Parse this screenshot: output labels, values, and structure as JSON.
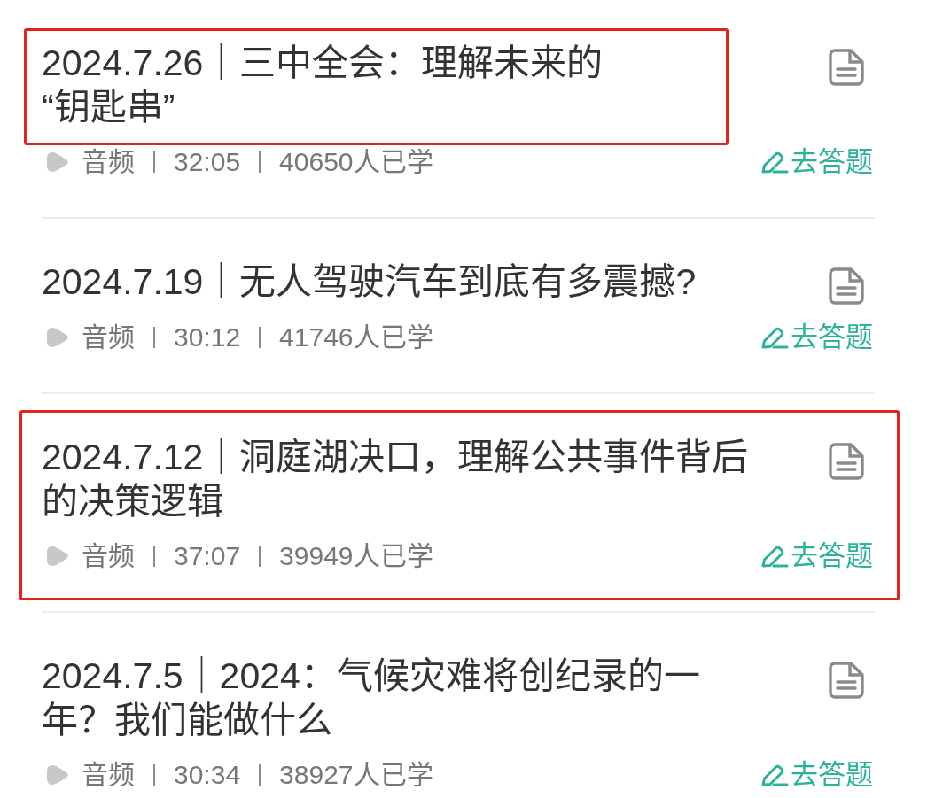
{
  "items": [
    {
      "title": "2024.7.26｜三中全会：理解未来的“钥匙串”",
      "title_highlighted": true,
      "highlighted": false,
      "type": "音频",
      "duration": "32:05",
      "learners": "40650人已学",
      "action": "去答题"
    },
    {
      "title": "2024.7.19｜无人驾驶汽车到底有多震撼?",
      "title_highlighted": false,
      "highlighted": false,
      "type": "音频",
      "duration": "30:12",
      "learners": "41746人已学",
      "action": "去答题"
    },
    {
      "title": "2024.7.12｜洞庭湖决口，理解公共事件背后的决策逻辑",
      "title_highlighted": false,
      "highlighted": true,
      "type": "音频",
      "duration": "37:07",
      "learners": "39949人已学",
      "action": "去答题"
    },
    {
      "title": "2024.7.5｜2024：气候灾难将创纪录的一年？我们能做什么",
      "title_highlighted": false,
      "highlighted": false,
      "type": "音频",
      "duration": "30:34",
      "learners": "38927人已学",
      "action": "去答题"
    }
  ]
}
